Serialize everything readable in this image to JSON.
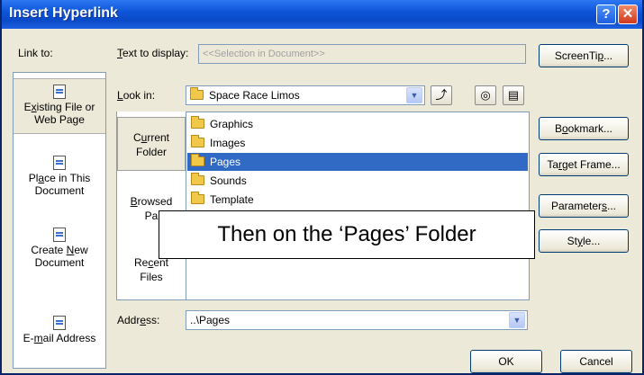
{
  "window": {
    "title": "Insert Hyperlink",
    "help_glyph": "?",
    "close_glyph": "✕"
  },
  "labels": {
    "link_to": "Link to:",
    "text_to_display_pre": "",
    "text_to_display_u": "T",
    "text_to_display_post": "ext to display:",
    "look_in_pre": "",
    "look_in_u": "L",
    "look_in_post": "ook in:",
    "address_pre": "Addr",
    "address_u": "e",
    "address_post": "ss:"
  },
  "fields": {
    "text_to_display": "<<Selection in Document>>",
    "look_in": "Space Race Limos",
    "address": "..\\Pages"
  },
  "link_to_items": [
    {
      "line1_pre": "E",
      "line1_u": "x",
      "line1_post": "isting File or",
      "line2": "Web Page"
    },
    {
      "line1_pre": "Pl",
      "line1_u": "a",
      "line1_post": "ce in This",
      "line2": "Document"
    },
    {
      "line1_pre": "Create ",
      "line1_u": "N",
      "line1_post": "ew",
      "line2": "Document"
    },
    {
      "line1_pre": "E-",
      "line1_u": "m",
      "line1_post": "ail Address",
      "line2": ""
    }
  ],
  "nav_items": [
    {
      "line1_pre": "C",
      "line1_u": "u",
      "line1_post": "rrent",
      "line2": "Folder"
    },
    {
      "line1_pre": "",
      "line1_u": "B",
      "line1_post": "rowsed",
      "line2": "Pa"
    },
    {
      "line1_pre": "Re",
      "line1_u": "c",
      "line1_post": "ent",
      "line2": "Files"
    }
  ],
  "files": [
    "Graphics",
    "Images",
    "Pages",
    "Sounds",
    "Template"
  ],
  "selected_file": "Pages",
  "buttons": {
    "screentip_pre": "ScreenTi",
    "screentip_u": "p",
    "screentip_post": "...",
    "bookmark_pre": "B",
    "bookmark_u": "o",
    "bookmark_post": "okmark...",
    "target_frame_pre": "Ta",
    "target_frame_u": "r",
    "target_frame_post": "get Frame...",
    "parameters_pre": "Parameter",
    "parameters_u": "s",
    "parameters_post": "...",
    "style_pre": "St",
    "style_u": "y",
    "style_post": "le...",
    "ok": "OK",
    "cancel": "Cancel"
  },
  "callout": "Then on the ‘Pages’ Folder",
  "colors": {
    "selection": "#316ac5",
    "titlebar": "#0a4ac8",
    "dialog_bg": "#ece9d8"
  }
}
